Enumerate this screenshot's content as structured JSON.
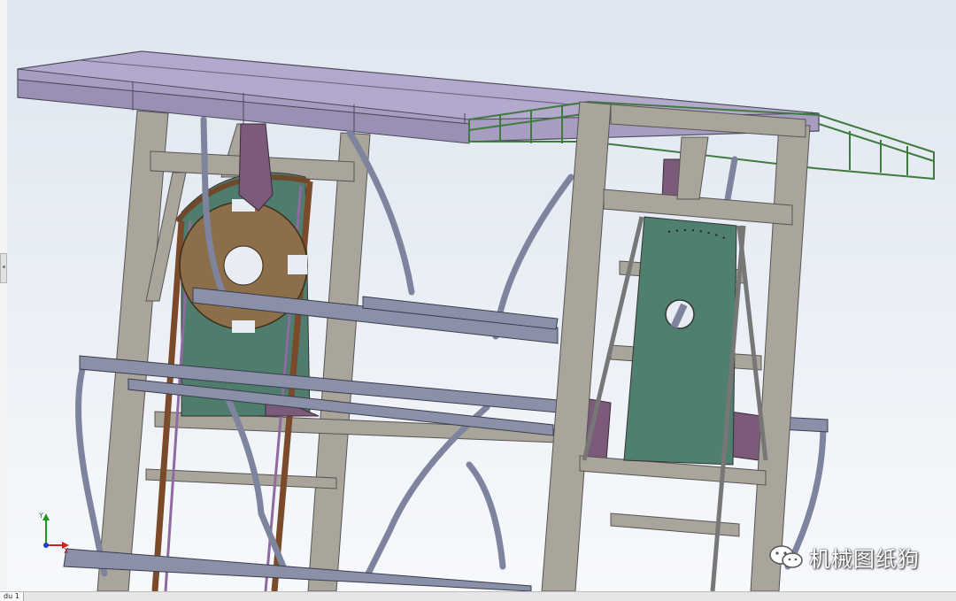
{
  "watermark": {
    "text": "机械图纸狗",
    "icon": "wechat-icon"
  },
  "statusbar": {
    "sheet_tab": "du 1"
  },
  "triad": {
    "y_label": "Y",
    "x_label": "X"
  },
  "colors": {
    "roof": "#a59bbf",
    "frame": "#a8a398",
    "panel": "#4f7f6e",
    "bracket": "#7a5a78",
    "tube": "#8a8fa6",
    "sprocket": "#8a6e4a",
    "grate": "#5fa05f"
  }
}
